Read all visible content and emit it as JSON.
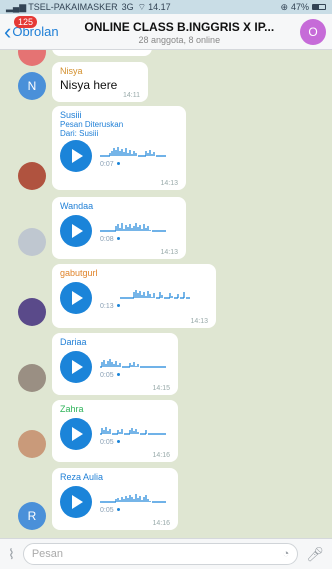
{
  "status": {
    "carrier": "TSEL-PAKAIMASKER",
    "network": "3G",
    "time": "14.17",
    "battery": "47%"
  },
  "header": {
    "back_label": "Obrolan",
    "unread_badge": "125",
    "title": "ONLINE CLASS B.INGGRIS X IP...",
    "subtitle": "28 anggota, 8 online",
    "avatar_letter": "O"
  },
  "messages": [
    {
      "sender": "Nisya",
      "text": "Nisya here",
      "time": "14:11",
      "avatar": "N",
      "color": "#d38f2c"
    },
    {
      "sender": "Susiii",
      "forward_label": "Pesan Diteruskan",
      "forward_from": "Dari: Susiii",
      "duration": "0:07",
      "time": "14:13",
      "color": "#1f7fd6"
    },
    {
      "sender": "Wandaa",
      "duration": "0:08",
      "time": "14:13",
      "color": "#1f7fd6"
    },
    {
      "sender": "gabutgurl",
      "duration": "0:13",
      "time": "14:13",
      "color": "#e0842a"
    },
    {
      "sender": "Dariaa",
      "duration": "0:05",
      "time": "14:15",
      "color": "#1f7fd6"
    },
    {
      "sender": "Zahra",
      "duration": "0:05",
      "time": "14:16",
      "color": "#2eb35a"
    },
    {
      "sender": "Reza Aulia",
      "duration": "0:05",
      "time": "14:16",
      "avatar": "R",
      "color": "#1f7fd6"
    }
  ],
  "composer": {
    "placeholder": "Pesan"
  }
}
